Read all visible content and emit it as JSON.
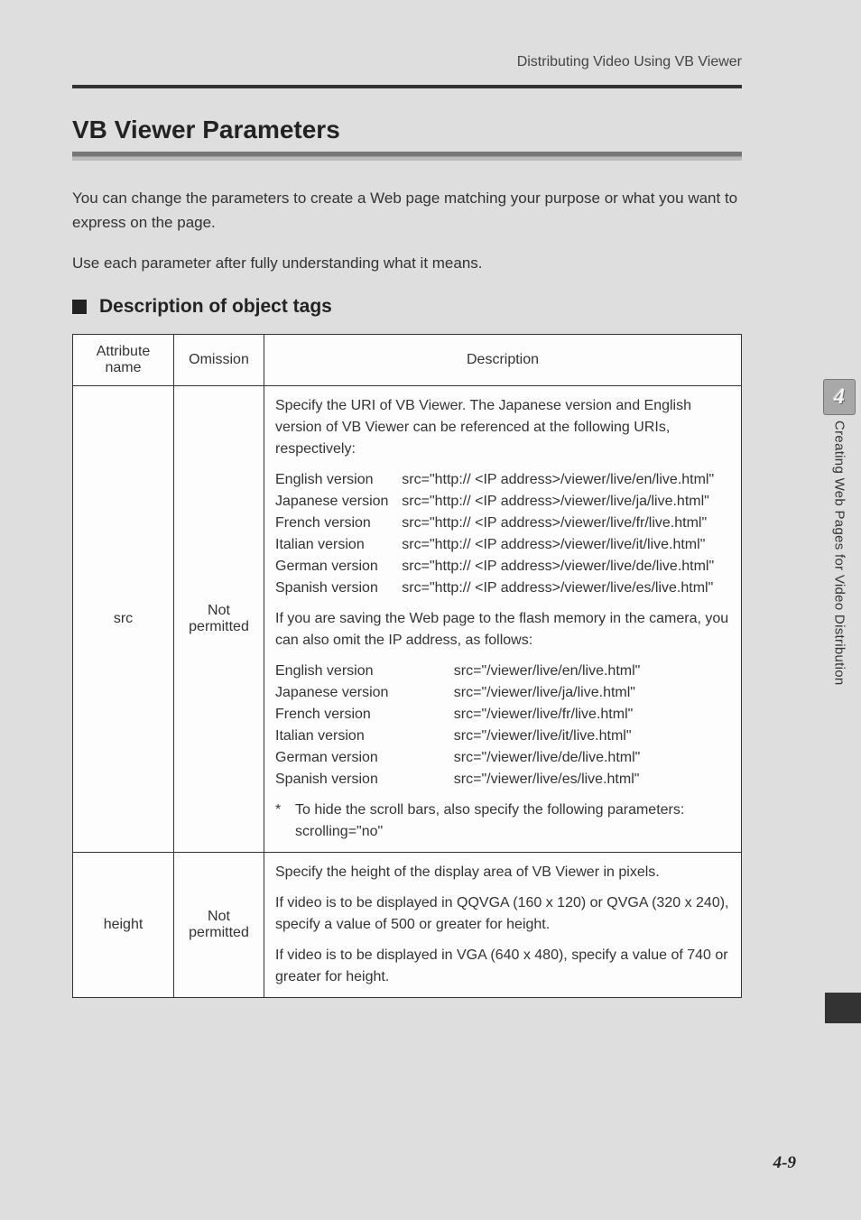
{
  "header": {
    "running": "Distributing Video Using VB Viewer"
  },
  "title": "VB Viewer Parameters",
  "intro1": "You can change the parameters to create a Web page matching your purpose or what you want to express on the page.",
  "intro2": "Use each parameter after fully understanding what it means.",
  "subhead": "Description of object tags",
  "table": {
    "head": {
      "c1": "Attribute name",
      "c2": "Omission",
      "c3": "Description"
    },
    "rows": [
      {
        "attr": "src",
        "omission": "Not permitted",
        "desc": {
          "p1": "Specify the URI of VB Viewer. The Japanese version and English version of VB Viewer can be referenced at the following URIs, respectively:",
          "full": [
            {
              "label": "English version",
              "val": "src=\"http:// <IP address>/viewer/live/en/live.html\""
            },
            {
              "label": "Japanese version",
              "val": "src=\"http:// <IP address>/viewer/live/ja/live.html\""
            },
            {
              "label": "French version",
              "val": "src=\"http:// <IP address>/viewer/live/fr/live.html\""
            },
            {
              "label": "Italian version",
              "val": "src=\"http:// <IP address>/viewer/live/it/live.html\""
            },
            {
              "label": "German version",
              "val": "src=\"http:// <IP address>/viewer/live/de/live.html\""
            },
            {
              "label": "Spanish version",
              "val": "src=\"http:// <IP address>/viewer/live/es/live.html\""
            }
          ],
          "p2": "If you are saving the Web page to the flash memory in the camera, you can also omit the IP address, as follows:",
          "rel": [
            {
              "label": "English version",
              "val": "src=\"/viewer/live/en/live.html\""
            },
            {
              "label": "Japanese version",
              "val": "src=\"/viewer/live/ja/live.html\""
            },
            {
              "label": "French version",
              "val": "src=\"/viewer/live/fr/live.html\""
            },
            {
              "label": "Italian version",
              "val": "src=\"/viewer/live/it/live.html\""
            },
            {
              "label": "German version",
              "val": "src=\"/viewer/live/de/live.html\""
            },
            {
              "label": "Spanish version",
              "val": "src=\"/viewer/live/es/live.html\""
            }
          ],
          "note_star": "*",
          "note": "To hide the scroll bars, also specify the following parameters: scrolling=\"no\""
        }
      },
      {
        "attr": "height",
        "omission": "Not permitted",
        "desc": {
          "p1": "Specify the height of the display area of VB Viewer in pixels.",
          "p2": "If video is to be displayed in QQVGA (160 x 120) or QVGA (320 x 240), specify a value of 500 or greater for height.",
          "p3": "If video is to be displayed in VGA (640 x 480), specify a value of 740 or greater for height."
        }
      }
    ]
  },
  "side": {
    "chapter": "4",
    "label": "Creating Web Pages for Video Distribution"
  },
  "pagenum": "4-9"
}
